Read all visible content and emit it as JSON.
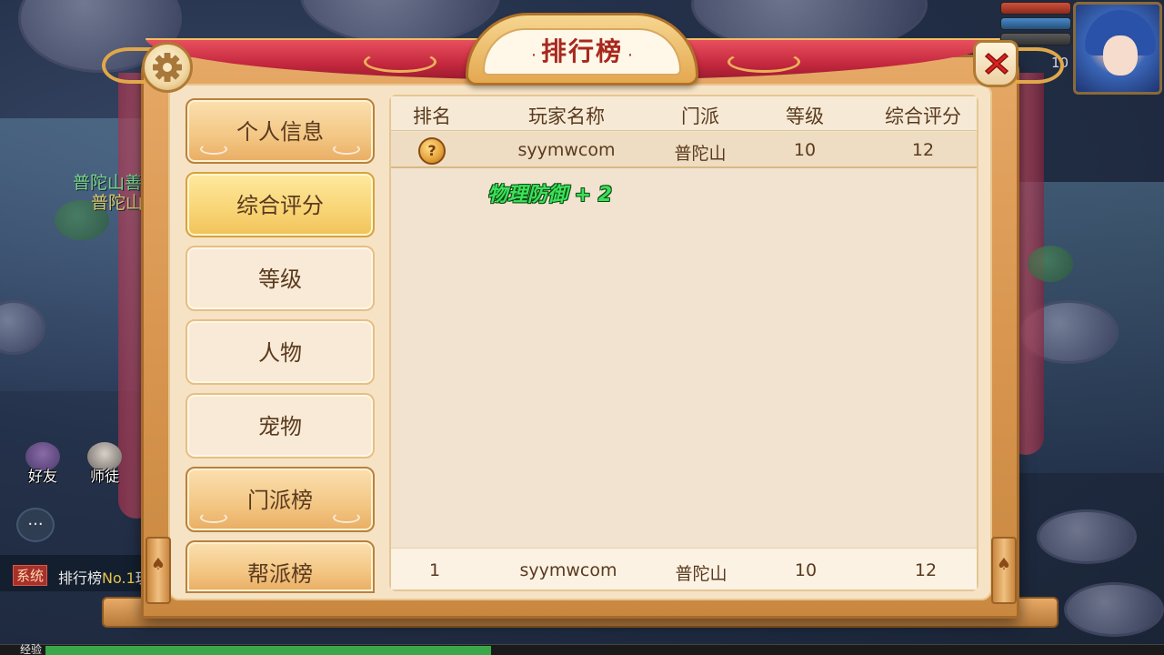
{
  "panel": {
    "title": "排行榜",
    "title_dots": [
      "·",
      "·"
    ]
  },
  "tabs": [
    {
      "label": "个人信息",
      "style": "gold"
    },
    {
      "label": "综合评分",
      "style": "active"
    },
    {
      "label": "等级",
      "style": "plain"
    },
    {
      "label": "人物",
      "style": "plain"
    },
    {
      "label": "宠物",
      "style": "plain"
    },
    {
      "label": "门派榜",
      "style": "gold"
    },
    {
      "label": "帮派榜",
      "style": "gold"
    }
  ],
  "table": {
    "headers": [
      "排名",
      "玩家名称",
      "门派",
      "等级",
      "综合评分"
    ],
    "rows": [
      {
        "rank": "?",
        "name": "syymwcom",
        "school": "普陀山",
        "level": "10",
        "score": "12"
      }
    ],
    "floating_text": "物理防御 + 2",
    "my_row": {
      "rank": "1",
      "name": "syymwcom",
      "school": "普陀山",
      "level": "10",
      "score": "12"
    }
  },
  "hud": {
    "player_level": "10",
    "npc_name_line1": "普陀山善",
    "npc_name_line2": "普陀山",
    "friends_label": "好友",
    "master_label": "师徒",
    "chat_tag": "系统",
    "chat_message_prefix": "排行榜",
    "chat_message_highlight": "No.1",
    "chat_message_suffix": "玩",
    "exp_label": "经验"
  },
  "colors": {
    "panel": "#e6a866",
    "inner": "#f6e3c5",
    "title_red": "#a8281e",
    "ribbon": "#c4283e",
    "floating_green": "#3ee05a"
  },
  "icons": {
    "settings": "gear-icon",
    "close": "close-icon",
    "rank_medal": "medal-icon",
    "chat": "chat-icon"
  }
}
